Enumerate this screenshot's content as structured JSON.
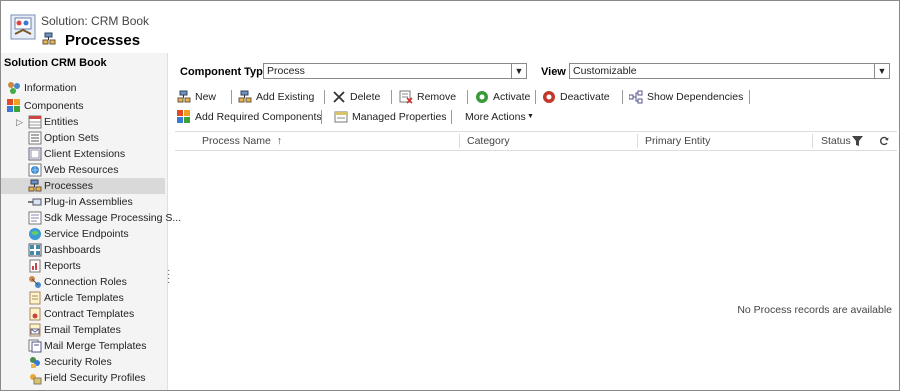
{
  "header": {
    "solution_label": "Solution: CRM Book",
    "page_title": "Processes"
  },
  "sidebar": {
    "title": "Solution CRM Book",
    "top_items": [
      {
        "label": "Information",
        "icon": "information-icon"
      },
      {
        "label": "Components",
        "icon": "components-icon"
      }
    ],
    "items": [
      {
        "label": "Entities",
        "icon": "entities-icon",
        "expandable": true
      },
      {
        "label": "Option Sets",
        "icon": "option-sets-icon"
      },
      {
        "label": "Client Extensions",
        "icon": "client-extensions-icon"
      },
      {
        "label": "Web Resources",
        "icon": "web-resources-icon"
      },
      {
        "label": "Processes",
        "icon": "processes-icon",
        "selected": true
      },
      {
        "label": "Plug-in Assemblies",
        "icon": "plugin-assemblies-icon"
      },
      {
        "label": "Sdk Message Processing S...",
        "icon": "sdk-message-icon"
      },
      {
        "label": "Service Endpoints",
        "icon": "service-endpoints-icon"
      },
      {
        "label": "Dashboards",
        "icon": "dashboards-icon"
      },
      {
        "label": "Reports",
        "icon": "reports-icon"
      },
      {
        "label": "Connection Roles",
        "icon": "connection-roles-icon"
      },
      {
        "label": "Article Templates",
        "icon": "article-templates-icon"
      },
      {
        "label": "Contract Templates",
        "icon": "contract-templates-icon"
      },
      {
        "label": "Email Templates",
        "icon": "email-templates-icon"
      },
      {
        "label": "Mail Merge Templates",
        "icon": "mail-merge-templates-icon"
      },
      {
        "label": "Security Roles",
        "icon": "security-roles-icon"
      },
      {
        "label": "Field Security Profiles",
        "icon": "field-security-profiles-icon"
      }
    ]
  },
  "filters": {
    "component_type_label": "Component Type",
    "component_type_value": "Process",
    "view_label": "View",
    "view_value": "Customizable"
  },
  "toolbar": {
    "row1": [
      {
        "label": "New",
        "icon": "new-process-icon"
      },
      {
        "label": "Add Existing",
        "icon": "add-existing-icon"
      },
      {
        "label": "Delete",
        "icon": "delete-icon"
      },
      {
        "label": "Remove",
        "icon": "remove-icon"
      },
      {
        "label": "Activate",
        "icon": "activate-icon"
      },
      {
        "label": "Deactivate",
        "icon": "deactivate-icon"
      },
      {
        "label": "Show Dependencies",
        "icon": "show-dependencies-icon"
      }
    ],
    "row2": [
      {
        "label": "Add Required Components",
        "icon": "add-required-icon"
      },
      {
        "label": "Managed Properties",
        "icon": "managed-properties-icon"
      },
      {
        "label": "More Actions",
        "icon": "chevron-down-icon"
      }
    ]
  },
  "grid": {
    "columns": [
      "Process Name",
      "Category",
      "Primary Entity",
      "Status"
    ],
    "sort_indicator": "↑",
    "empty_message": "No Process records are available"
  },
  "colors": {
    "selected_bg": "#d9d9d9",
    "sidebar_bg": "#f4f4f4",
    "activate_green": "#3a9a3a",
    "deactivate_red": "#c0392b"
  }
}
